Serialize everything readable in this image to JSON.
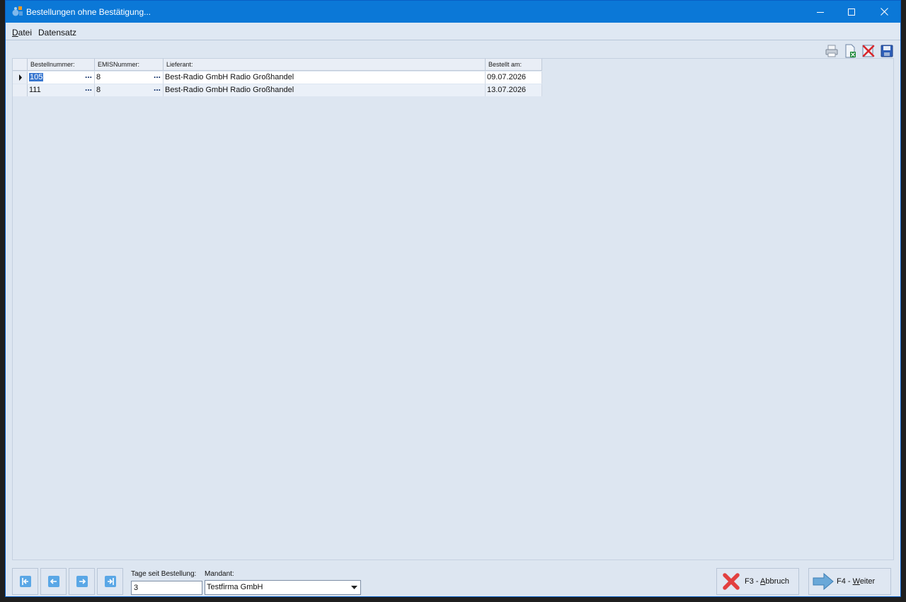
{
  "window": {
    "title": "Bestellungen ohne Bestätigung..."
  },
  "menu": {
    "items": [
      {
        "accel": "D",
        "rest": "atei"
      },
      {
        "accel": "",
        "rest": "Datensatz"
      }
    ]
  },
  "toolbar": {
    "icons": [
      "printer-icon",
      "export-excel-icon",
      "delete-icon",
      "save-icon"
    ]
  },
  "grid": {
    "columns": [
      "Bestellnummer:",
      "EMISNummer:",
      "Lieferant:",
      "Bestellt am:"
    ],
    "rows": [
      {
        "bestellnummer": "105",
        "emisnummer": "8",
        "lieferant": "Best-Radio GmbH Radio Großhandel",
        "bestellt_am": "09.07.2026"
      },
      {
        "bestellnummer": "111",
        "emisnummer": "8",
        "lieferant": "Best-Radio GmbH Radio Großhandel",
        "bestellt_am": "13.07.2026"
      }
    ],
    "ellipsis": "..."
  },
  "bottom": {
    "tage_label": "Tage seit Bestellung:",
    "tage_value": "3",
    "mandant_label": "Mandant:",
    "mandant_value": "Testfirma GmbH"
  },
  "buttons": {
    "abbruch_prefix": "F3 - ",
    "abbruch_accel": "A",
    "abbruch_rest": "bbruch",
    "weiter_prefix": "F4 - ",
    "weiter_accel": "W",
    "weiter_rest": "eiter"
  },
  "colors": {
    "titlebar": "#0b78d7",
    "background": "#dde6f1",
    "selection": "#3a78d0"
  }
}
